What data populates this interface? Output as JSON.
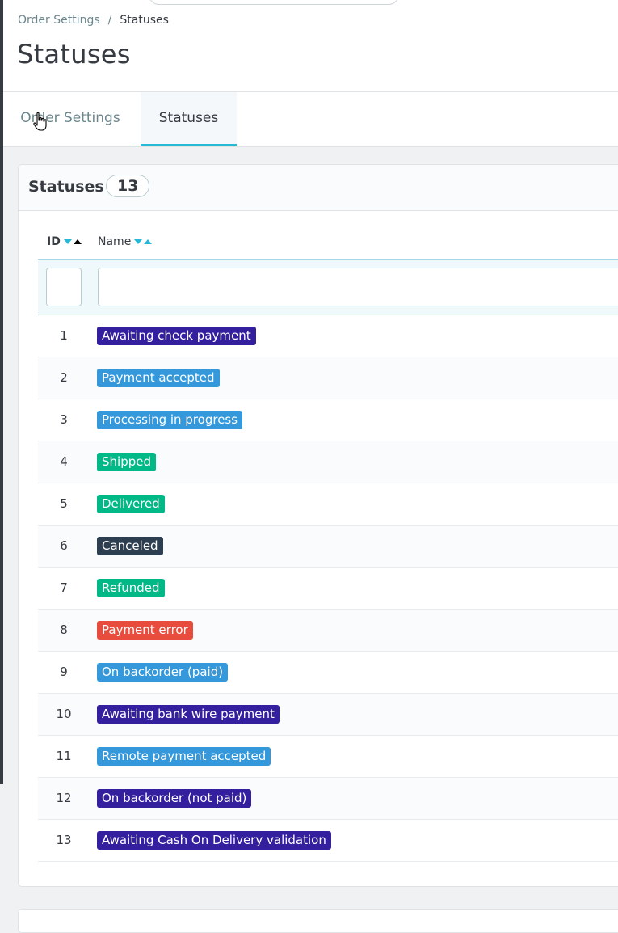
{
  "breadcrumb": {
    "parent": "Order Settings",
    "separator": "/",
    "current": "Statuses"
  },
  "page_title": "Statuses",
  "tabs": [
    {
      "label": "Order Settings",
      "active": false
    },
    {
      "label": "Statuses",
      "active": true
    }
  ],
  "card": {
    "title": "Statuses",
    "count": "13"
  },
  "columns": {
    "id": "ID",
    "name": "Name"
  },
  "filters": {
    "id_value": "",
    "name_value": ""
  },
  "colors": {
    "accent": "#25b9d7",
    "purple": "#34209e",
    "blue": "#3498db",
    "green": "#01b887",
    "dark": "#2c3e50",
    "red": "#e74c3c"
  },
  "statuses": [
    {
      "id": "1",
      "name": "Awaiting check payment",
      "color": "#34209e"
    },
    {
      "id": "2",
      "name": "Payment accepted",
      "color": "#3498db"
    },
    {
      "id": "3",
      "name": "Processing in progress",
      "color": "#3498db"
    },
    {
      "id": "4",
      "name": "Shipped",
      "color": "#01b887"
    },
    {
      "id": "5",
      "name": "Delivered",
      "color": "#01b887"
    },
    {
      "id": "6",
      "name": "Canceled",
      "color": "#2c3e50"
    },
    {
      "id": "7",
      "name": "Refunded",
      "color": "#01b887"
    },
    {
      "id": "8",
      "name": "Payment error",
      "color": "#e74c3c"
    },
    {
      "id": "9",
      "name": "On backorder (paid)",
      "color": "#3498db"
    },
    {
      "id": "10",
      "name": "Awaiting bank wire payment",
      "color": "#34209e"
    },
    {
      "id": "11",
      "name": "Remote payment accepted",
      "color": "#3498db"
    },
    {
      "id": "12",
      "name": "On backorder (not paid)",
      "color": "#34209e"
    },
    {
      "id": "13",
      "name": "Awaiting Cash On Delivery validation",
      "color": "#34209e"
    }
  ]
}
